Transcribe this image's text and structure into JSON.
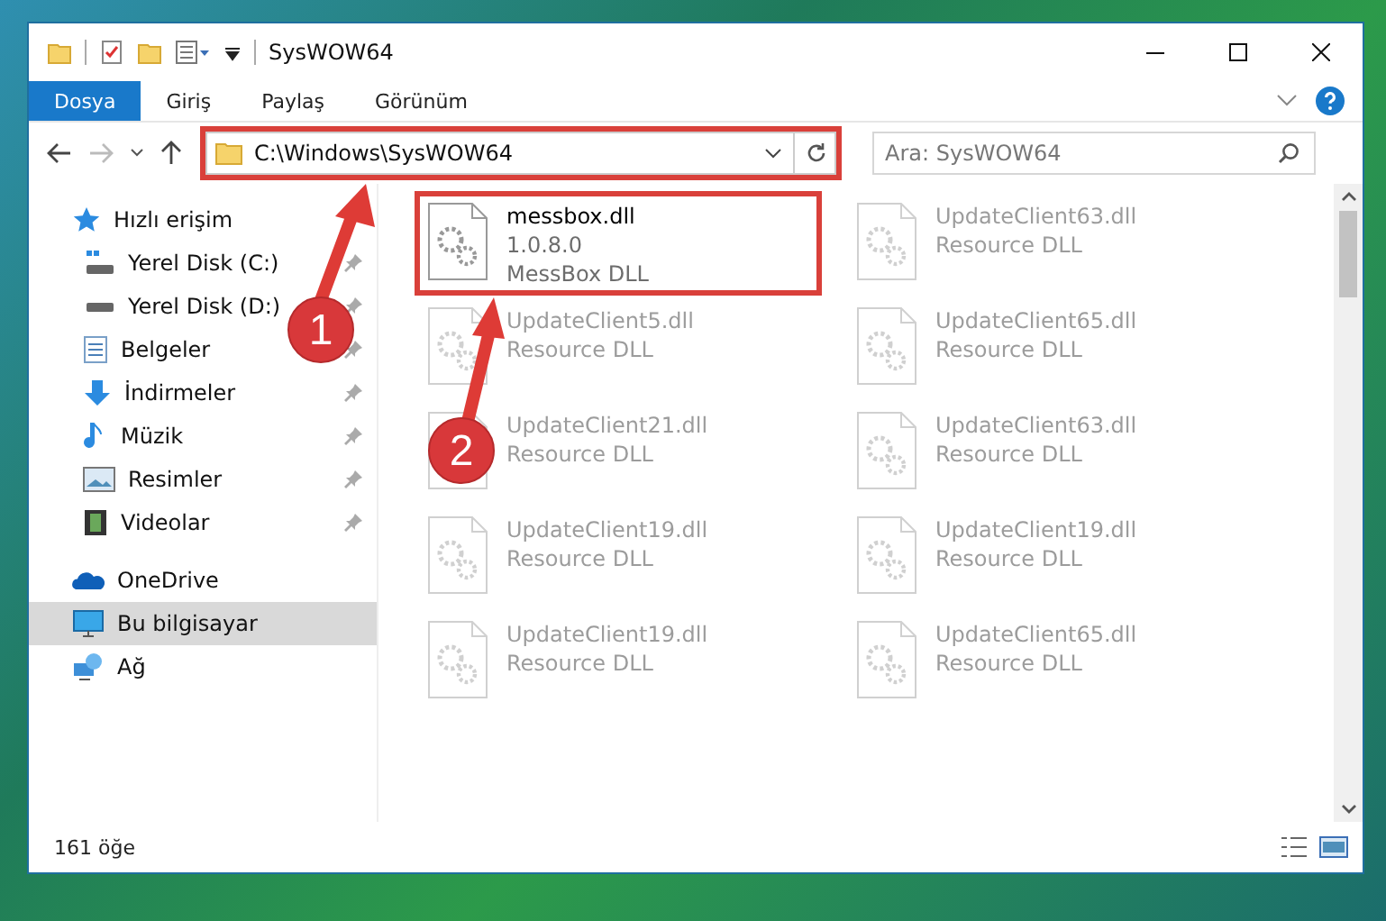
{
  "window": {
    "title": "SysWOW64"
  },
  "ribbon_tabs": [
    {
      "label": "Dosya",
      "selected": true
    },
    {
      "label": "Giriş",
      "selected": false
    },
    {
      "label": "Paylaş",
      "selected": false
    },
    {
      "label": "Görünüm",
      "selected": false
    }
  ],
  "address_bar": {
    "path": "C:\\Windows\\SysWOW64",
    "highlighted": true
  },
  "search": {
    "placeholder": "Ara: SysWOW64"
  },
  "sidebar": {
    "items": [
      {
        "label": "Hızlı erişim",
        "kind": "star",
        "selected": false,
        "children": [
          {
            "label": "Yerel Disk (C:)",
            "kind": "drive-system",
            "selected": false,
            "pinned": true
          },
          {
            "label": "Yerel Disk (D:)",
            "kind": "drive",
            "selected": false,
            "pinned": true
          },
          {
            "label": "Belgeler",
            "kind": "document",
            "selected": false,
            "pinned": true
          },
          {
            "label": "İndirmeler",
            "kind": "download",
            "selected": false,
            "pinned": true
          },
          {
            "label": "Müzik",
            "kind": "music",
            "selected": false,
            "pinned": true
          },
          {
            "label": "Resimler",
            "kind": "picture",
            "selected": false,
            "pinned": true
          },
          {
            "label": "Videolar",
            "kind": "video",
            "selected": false,
            "pinned": true
          }
        ]
      },
      {
        "label": "OneDrive",
        "kind": "cloud",
        "selected": false
      },
      {
        "label": "Bu bilgisayar",
        "kind": "computer",
        "selected": true
      },
      {
        "label": "Ağ",
        "kind": "network",
        "selected": false
      }
    ]
  },
  "files": [
    {
      "name": "messbox.dll",
      "details": [
        "1.0.8.0",
        "MessBox DLL"
      ],
      "faded": false,
      "highlighted": true
    },
    {
      "name": "UpdateClient63.dll",
      "details": [
        "Resource DLL"
      ],
      "faded": true,
      "highlighted": false
    },
    {
      "name": "UpdateClient5.dll",
      "details": [
        "Resource DLL"
      ],
      "faded": true,
      "highlighted": false
    },
    {
      "name": "UpdateClient65.dll",
      "details": [
        "Resource DLL"
      ],
      "faded": true,
      "highlighted": false
    },
    {
      "name": "UpdateClient21.dll",
      "details": [
        "Resource DLL"
      ],
      "faded": true,
      "highlighted": false
    },
    {
      "name": "UpdateClient63.dll",
      "details": [
        "Resource DLL"
      ],
      "faded": true,
      "highlighted": false
    },
    {
      "name": "UpdateClient19.dll",
      "details": [
        "Resource DLL"
      ],
      "faded": true,
      "highlighted": false
    },
    {
      "name": "UpdateClient19.dll",
      "details": [
        "Resource DLL"
      ],
      "faded": true,
      "highlighted": false
    },
    {
      "name": "UpdateClient19.dll",
      "details": [
        "Resource DLL"
      ],
      "faded": true,
      "highlighted": false
    },
    {
      "name": "UpdateClient65.dll",
      "details": [
        "Resource DLL"
      ],
      "faded": true,
      "highlighted": false
    }
  ],
  "status_bar": {
    "item_count": "161 öğe"
  },
  "annotations": [
    {
      "number": "1"
    },
    {
      "number": "2"
    }
  ]
}
